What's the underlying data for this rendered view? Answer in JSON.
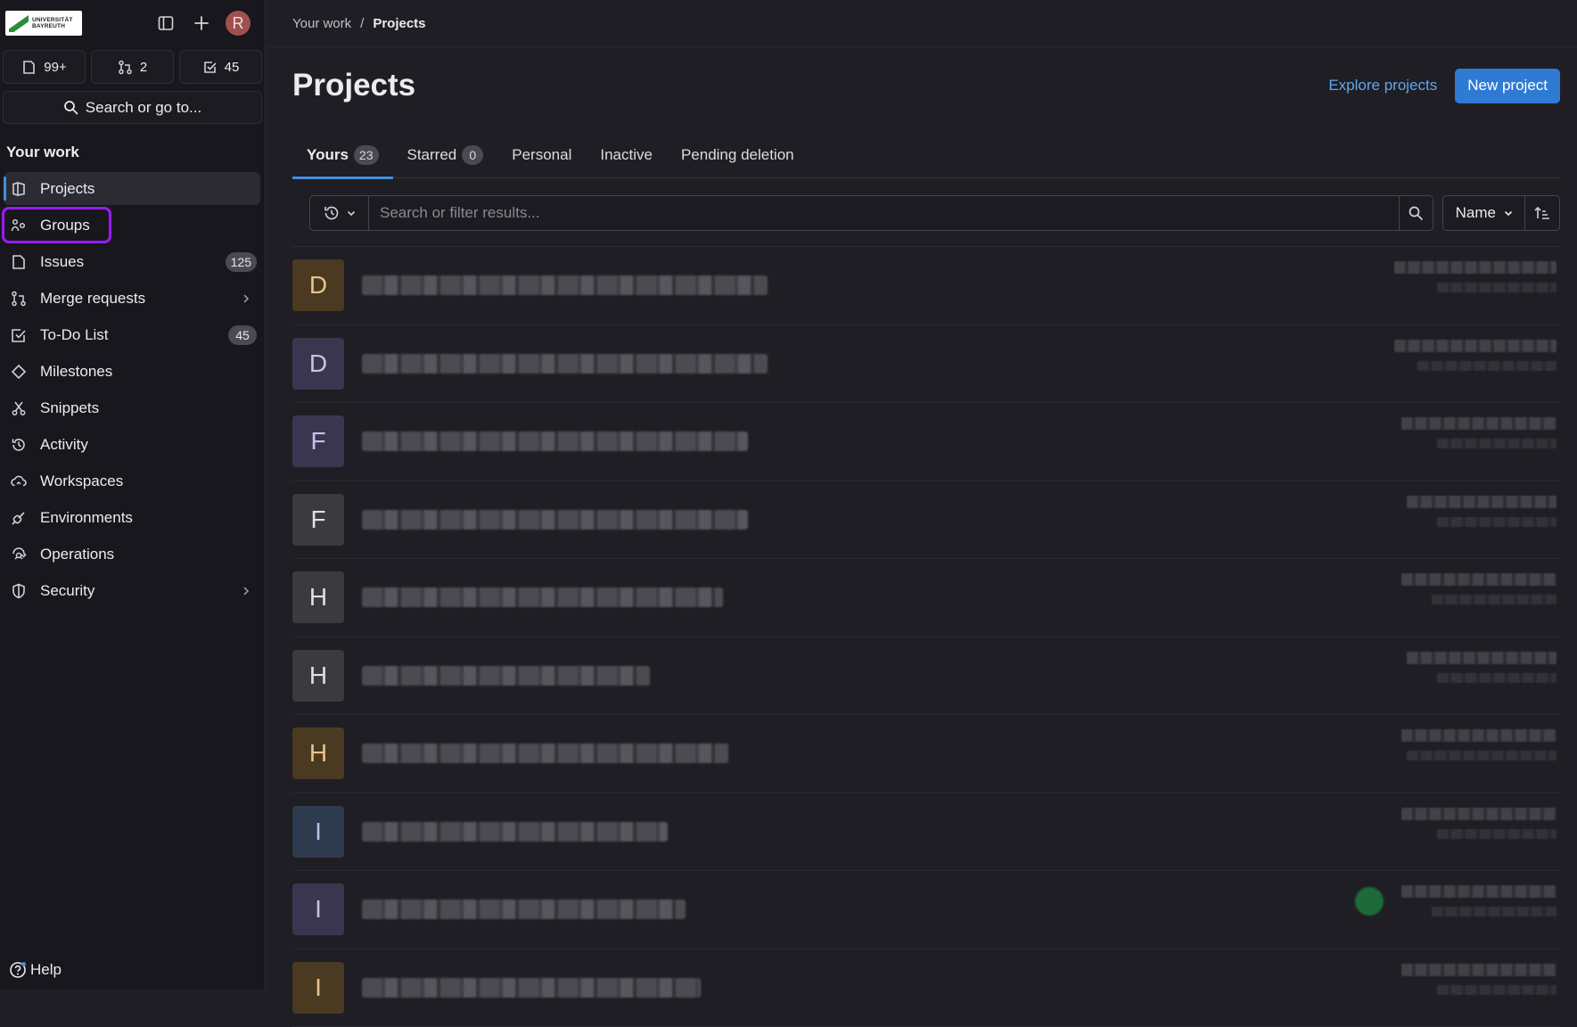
{
  "header": {
    "logo_text_1": "UNIVERSITÄT",
    "logo_text_2": "BAYREUTH",
    "avatar_initial": "R"
  },
  "counters": [
    {
      "icon": "issues-icon",
      "value": "99+"
    },
    {
      "icon": "merge-request-icon",
      "value": "2"
    },
    {
      "icon": "todo-icon",
      "value": "45"
    }
  ],
  "search": {
    "label": "Search or go to..."
  },
  "sidebar": {
    "section_title": "Your work",
    "items": [
      {
        "label": "Projects",
        "icon": "project-icon"
      },
      {
        "label": "Groups",
        "icon": "group-icon"
      },
      {
        "label": "Issues",
        "icon": "issues-icon",
        "badge": "125"
      },
      {
        "label": "Merge requests",
        "icon": "merge-request-icon"
      },
      {
        "label": "To-Do List",
        "icon": "todo-icon",
        "badge": "45"
      },
      {
        "label": "Milestones",
        "icon": "milestone-icon"
      },
      {
        "label": "Snippets",
        "icon": "snippet-icon"
      },
      {
        "label": "Activity",
        "icon": "history-icon"
      },
      {
        "label": "Workspaces",
        "icon": "workspace-icon"
      },
      {
        "label": "Environments",
        "icon": "environment-icon"
      },
      {
        "label": "Operations",
        "icon": "operations-icon"
      },
      {
        "label": "Security",
        "icon": "shield-icon"
      }
    ],
    "help_label": "Help"
  },
  "breadcrumb": {
    "parent": "Your work",
    "separator": "/",
    "current": "Projects"
  },
  "page": {
    "title": "Projects",
    "explore_label": "Explore projects",
    "new_label": "New project"
  },
  "tabs": [
    {
      "label": "Yours",
      "count": "23"
    },
    {
      "label": "Starred",
      "count": "0"
    },
    {
      "label": "Personal"
    },
    {
      "label": "Inactive"
    },
    {
      "label": "Pending deletion"
    }
  ],
  "filter": {
    "placeholder": "Search or filter results...",
    "sort_label": "Name"
  },
  "projects": [
    {
      "initial": "D",
      "color": "#4a3a22",
      "text_color": "#e8c48a"
    },
    {
      "initial": "D",
      "color": "#3b3650",
      "text_color": "#c8c0e8"
    },
    {
      "initial": "F",
      "color": "#3b3650",
      "text_color": "#c8c0e8"
    },
    {
      "initial": "F",
      "color": "#3a3a3f",
      "text_color": "#e0e0e4"
    },
    {
      "initial": "H",
      "color": "#3a3a3f",
      "text_color": "#e0e0e4"
    },
    {
      "initial": "H",
      "color": "#3a3a3f",
      "text_color": "#e0e0e4"
    },
    {
      "initial": "H",
      "color": "#4a3a22",
      "text_color": "#e8c48a"
    },
    {
      "initial": "I",
      "color": "#2e3a4e",
      "text_color": "#a8c4ea"
    },
    {
      "initial": "I",
      "color": "#3b3650",
      "text_color": "#c8c0e8"
    },
    {
      "initial": "I",
      "color": "#4a3a22",
      "text_color": "#e8c48a"
    }
  ],
  "colors": {
    "accent": "#428fdc",
    "primary_button": "#2f7bd4",
    "highlight_outline": "#9a1bff"
  }
}
